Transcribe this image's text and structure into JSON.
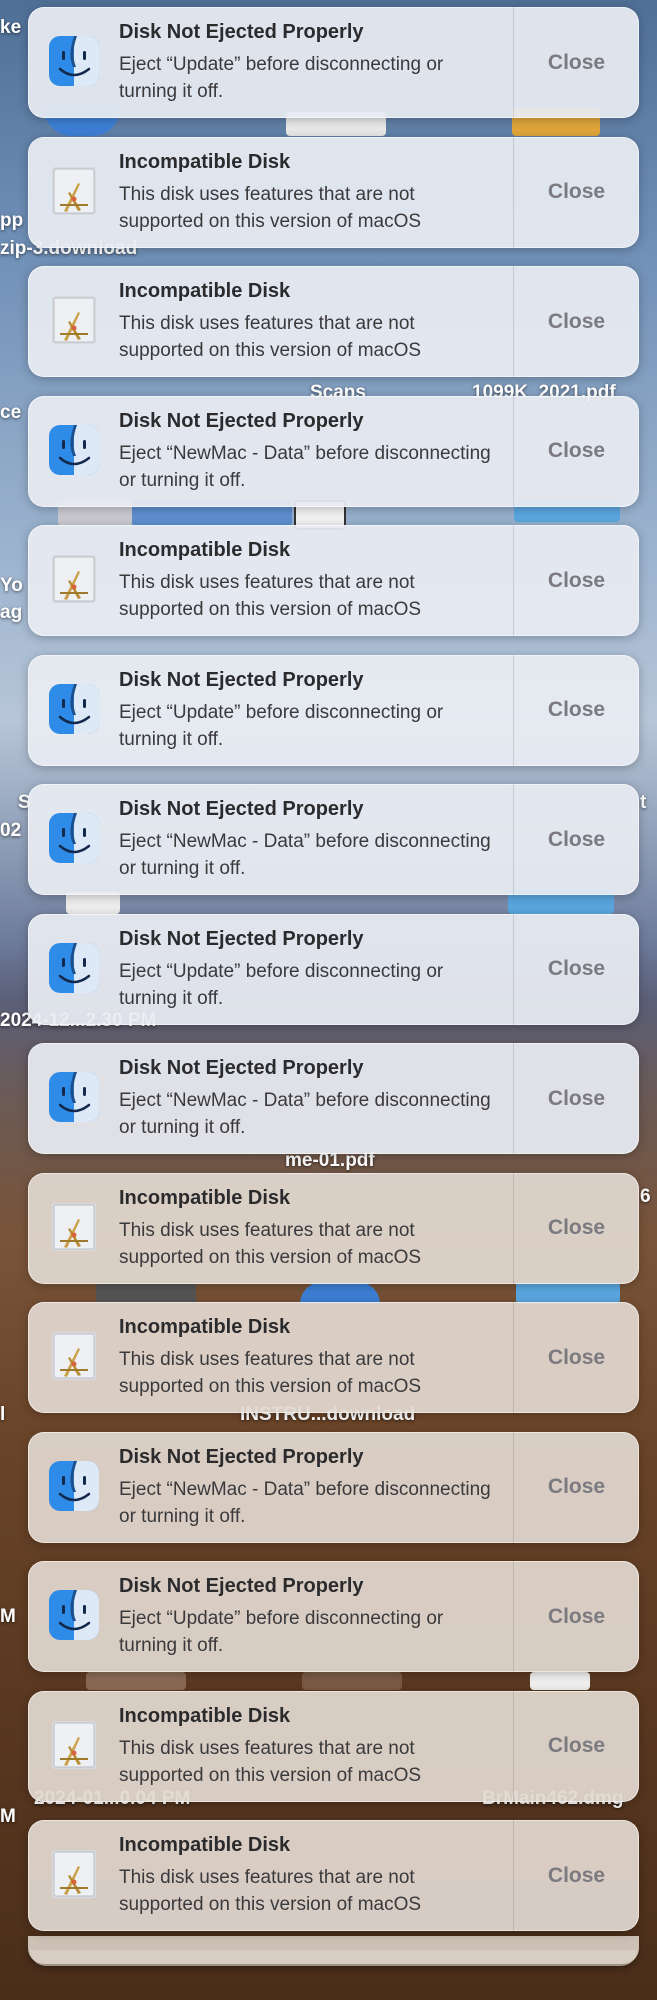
{
  "desktop": {
    "labels": [
      "ke",
      "pp",
      "zip-3.download",
      "Scans",
      "1099K_2021.pdf",
      "ce",
      "Yo",
      "ag",
      "S",
      "t",
      "02",
      "2024-12...2.30 PM",
      "me-01.pdf",
      "6",
      "INSTRU...download",
      "l",
      "M",
      "2024-01...0.04 PM",
      "BrMain462.dmg",
      "M"
    ]
  },
  "notifications": [
    {
      "type": "eject",
      "title": "Disk Not Ejected Properly",
      "text": "Eject “Update” before disconnecting or turning it off.",
      "close": "Close"
    },
    {
      "type": "incompatible",
      "title": "Incompatible Disk",
      "text": "This disk uses features that are not supported on this version of macOS",
      "close": "Close"
    },
    {
      "type": "incompatible",
      "title": "Incompatible Disk",
      "text": "This disk uses features that are not supported on this version of macOS",
      "close": "Close"
    },
    {
      "type": "eject",
      "title": "Disk Not Ejected Properly",
      "text": "Eject “NewMac - Data” before disconnecting or turning it off.",
      "close": "Close"
    },
    {
      "type": "incompatible",
      "title": "Incompatible Disk",
      "text": "This disk uses features that are not supported on this version of macOS",
      "close": "Close"
    },
    {
      "type": "eject",
      "title": "Disk Not Ejected Properly",
      "text": "Eject “Update” before disconnecting or turning it off.",
      "close": "Close"
    },
    {
      "type": "eject",
      "title": "Disk Not Ejected Properly",
      "text": "Eject “NewMac - Data” before disconnecting or turning it off.",
      "close": "Close"
    },
    {
      "type": "eject",
      "title": "Disk Not Ejected Properly",
      "text": "Eject “Update” before disconnecting or turning it off.",
      "close": "Close"
    },
    {
      "type": "eject",
      "title": "Disk Not Ejected Properly",
      "text": "Eject “NewMac - Data” before disconnecting or turning it off.",
      "close": "Close"
    },
    {
      "type": "incompatible",
      "title": "Incompatible Disk",
      "text": "This disk uses features that are not supported on this version of macOS",
      "close": "Close"
    },
    {
      "type": "incompatible",
      "title": "Incompatible Disk",
      "text": "This disk uses features that are not supported on this version of macOS",
      "close": "Close"
    },
    {
      "type": "eject",
      "title": "Disk Not Ejected Properly",
      "text": "Eject “NewMac - Data” before disconnecting or turning it off.",
      "close": "Close"
    },
    {
      "type": "eject",
      "title": "Disk Not Ejected Properly",
      "text": "Eject “Update” before disconnecting or turning it off.",
      "close": "Close"
    },
    {
      "type": "incompatible",
      "title": "Incompatible Disk",
      "text": "This disk uses features that are not supported on this version of macOS",
      "close": "Close"
    },
    {
      "type": "incompatible",
      "title": "Incompatible Disk",
      "text": "This disk uses features that are not supported on this version of macOS",
      "close": "Close"
    }
  ],
  "icons": {
    "eject": "finder-icon",
    "incompatible": "disk-utility-icon"
  },
  "colors": {
    "card_cool": "#e8ecf2",
    "card_warm": "#e2d8d0",
    "close_text": "#7a7a80"
  }
}
